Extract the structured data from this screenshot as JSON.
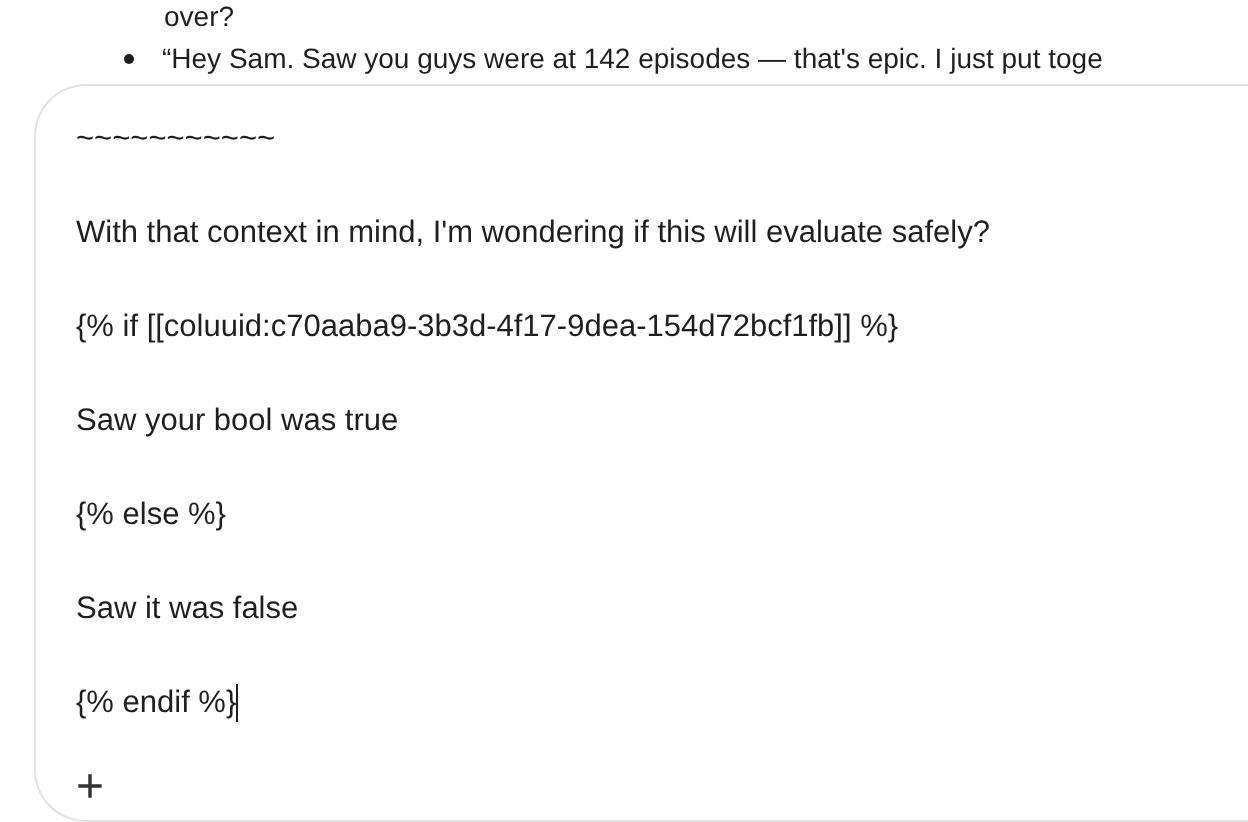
{
  "background_message": {
    "lines": [
      {
        "kind": "plain",
        "text": "over?"
      },
      {
        "kind": "bullet",
        "text": "“Hey Sam. Saw you guys were at 142 episodes — that's epic. I just put toge"
      }
    ]
  },
  "editor": {
    "lines": [
      "~~~~~~~~~~~",
      "With that context in mind, I'm wondering if this will evaluate safely?",
      "{% if [[coluuid:c70aaba9-3b3d-4f17-9dea-154d72bcf1fb]] %}",
      "Saw your bool was true",
      "{% else %}",
      "Saw it was false",
      "{% endif %}"
    ],
    "add_button": "+"
  }
}
